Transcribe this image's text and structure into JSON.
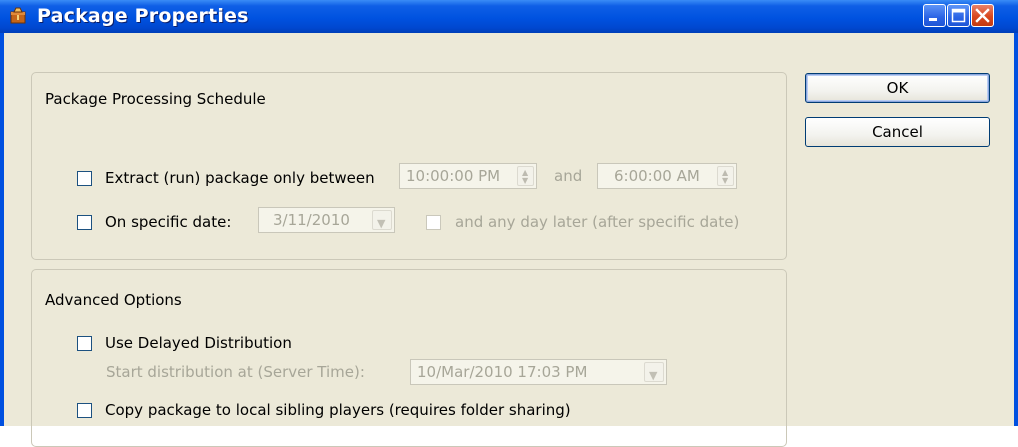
{
  "window": {
    "title": "Package Properties"
  },
  "buttons": {
    "ok": "OK",
    "cancel": "Cancel"
  },
  "schedule": {
    "title": "Package Processing Schedule",
    "extract_label": "Extract (run) package only between",
    "start_time": "10:00:00 PM",
    "and_label": "and",
    "end_time": "6:00:00 AM",
    "specific_date_label": "On specific date:",
    "date_value": "3/11/2010",
    "any_day_later_label": "and any day later (after specific date)"
  },
  "advanced": {
    "title": "Advanced Options",
    "delayed_label": "Use Delayed Distribution",
    "start_distribution_label": "Start distribution at (Server Time):",
    "start_distribution_value": "10/Mar/2010 17:03 PM",
    "copy_label": "Copy package to local sibling players (requires folder sharing)"
  },
  "icons": {
    "title_icon": "package-icon",
    "minimize": "minimize-icon",
    "maximize": "maximize-icon",
    "close": "close-icon",
    "spin": "spin-up-down-icon",
    "dropdown": "chevron-down-icon"
  },
  "colors": {
    "titlebar": "#0052e0",
    "client_bg": "#ece9d8",
    "disabled_text": "#a7a698",
    "button_border": "#003c74"
  }
}
